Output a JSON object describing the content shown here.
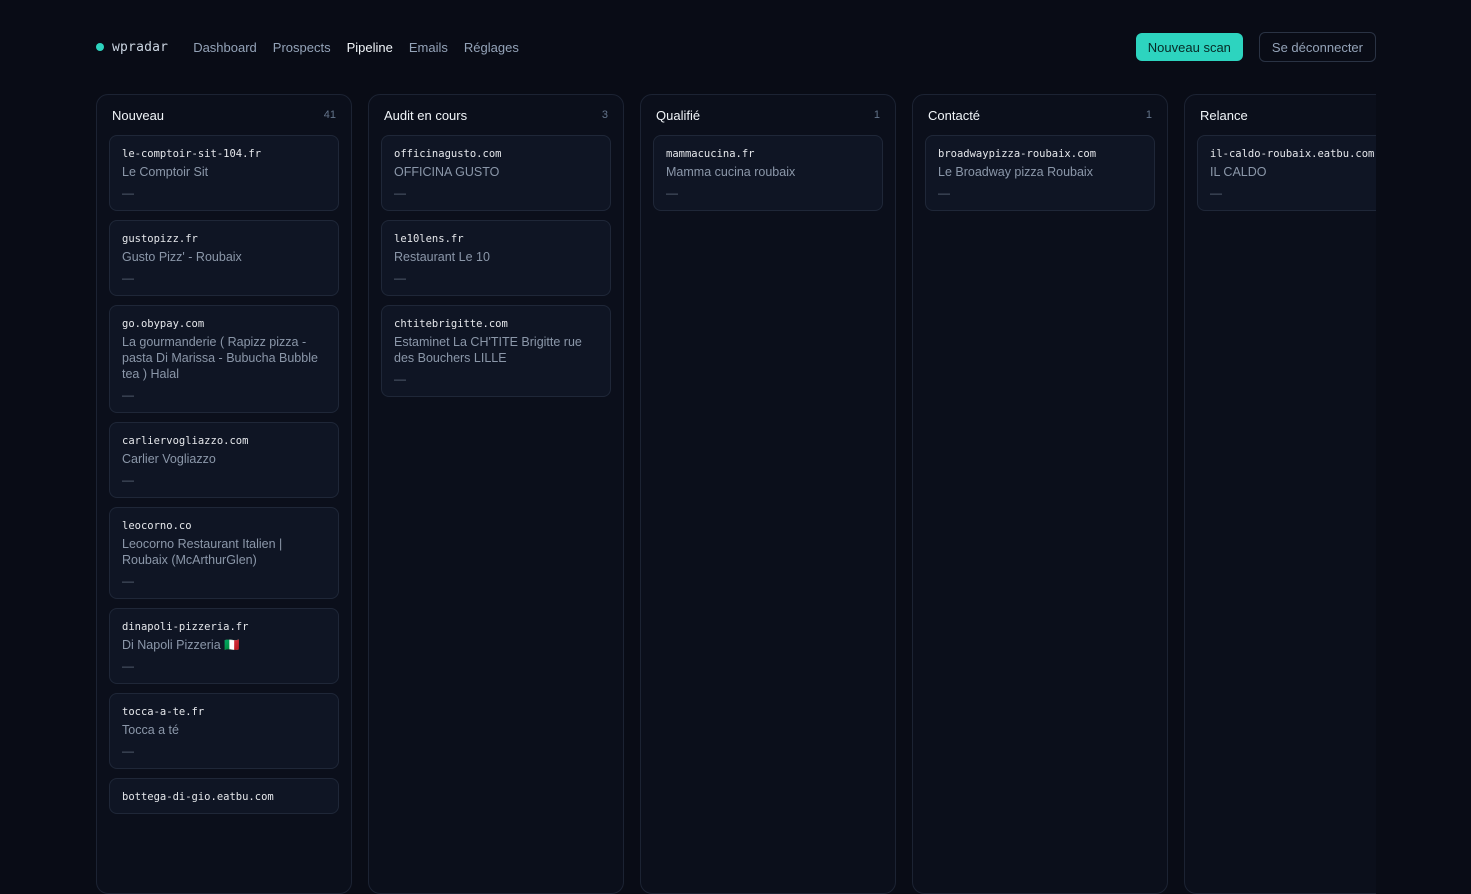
{
  "brand": {
    "name": "wpradar",
    "dot_color": "#2dd4bf"
  },
  "nav": [
    {
      "label": "Dashboard",
      "active": false
    },
    {
      "label": "Prospects",
      "active": false
    },
    {
      "label": "Pipeline",
      "active": true
    },
    {
      "label": "Emails",
      "active": false
    },
    {
      "label": "Réglages",
      "active": false
    }
  ],
  "actions": {
    "new_scan": "Nouveau scan",
    "logout": "Se déconnecter"
  },
  "colors": {
    "accent": "#2dd4bf",
    "background": "#090c16"
  },
  "columns": [
    {
      "title": "Nouveau",
      "count": "41",
      "cards": [
        {
          "domain": "le-comptoir-sit-104.fr",
          "name": "Le Comptoir Sit",
          "meta": "—"
        },
        {
          "domain": "gustopizz.fr",
          "name": "Gusto Pizz' - Roubaix",
          "meta": "—"
        },
        {
          "domain": "go.obypay.com",
          "name": "La gourmanderie ( Rapizz pizza - pasta Di Marissa - Bubucha Bubble tea ) Halal",
          "meta": "—"
        },
        {
          "domain": "carliervogliazzo.com",
          "name": "Carlier Vogliazzo",
          "meta": "—"
        },
        {
          "domain": "leocorno.co",
          "name": "Leocorno Restaurant Italien | Roubaix (McArthurGlen)",
          "meta": "—"
        },
        {
          "domain": "dinapoli-pizzeria.fr",
          "name": "Di Napoli Pizzeria 🇮🇹",
          "meta": "—"
        },
        {
          "domain": "tocca-a-te.fr",
          "name": "Tocca a té",
          "meta": "—"
        },
        {
          "domain": "bottega-di-gio.eatbu.com",
          "name": "",
          "meta": ""
        }
      ]
    },
    {
      "title": "Audit en cours",
      "count": "3",
      "cards": [
        {
          "domain": "officinagusto.com",
          "name": "OFFICINA GUSTO",
          "meta": "—"
        },
        {
          "domain": "le10lens.fr",
          "name": "Restaurant Le 10",
          "meta": "—"
        },
        {
          "domain": "chtitebrigitte.com",
          "name": "Estaminet La CH'TITE Brigitte rue des Bouchers LILLE",
          "meta": "—"
        }
      ]
    },
    {
      "title": "Qualifié",
      "count": "1",
      "cards": [
        {
          "domain": "mammacucina.fr",
          "name": "Mamma cucina roubaix",
          "meta": "—"
        }
      ]
    },
    {
      "title": "Contacté",
      "count": "1",
      "cards": [
        {
          "domain": "broadwaypizza-roubaix.com",
          "name": "Le Broadway pizza Roubaix",
          "meta": "—"
        }
      ]
    },
    {
      "title": "Relance",
      "count": "",
      "cards": [
        {
          "domain": "il-caldo-roubaix.eatbu.com",
          "name": "IL CALDO",
          "meta": "—"
        }
      ]
    }
  ]
}
